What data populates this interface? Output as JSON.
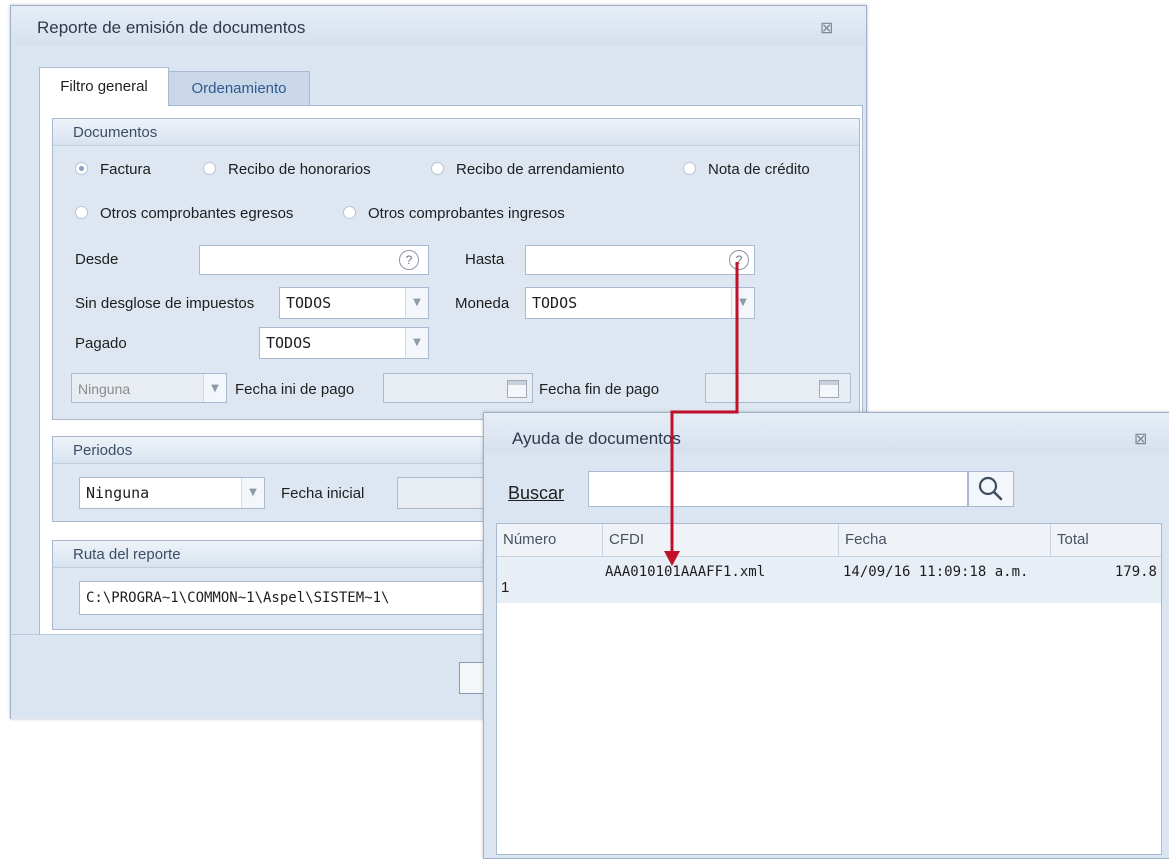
{
  "main_dialog": {
    "title": "Reporte de emisión de documentos",
    "close_glyph": "⊠",
    "tabs": [
      {
        "label": "Filtro general",
        "active": true
      },
      {
        "label": "Ordenamiento",
        "active": false
      }
    ],
    "documentos": {
      "title": "Documentos",
      "doc_types": [
        {
          "label": "Factura",
          "selected": true
        },
        {
          "label": "Recibo de honorarios",
          "selected": false
        },
        {
          "label": "Recibo de arrendamiento",
          "selected": false
        },
        {
          "label": "Nota de crédito",
          "selected": false
        },
        {
          "label": "Otros comprobantes egresos",
          "selected": false
        },
        {
          "label": "Otros comprobantes ingresos",
          "selected": false
        }
      ],
      "desde_label": "Desde",
      "desde_value": "",
      "hasta_label": "Hasta",
      "hasta_value": "",
      "help_glyph": "?",
      "sin_desglose_label": "Sin desglose de impuestos",
      "sin_desglose_value": "TODOS",
      "moneda_label": "Moneda",
      "moneda_value": "TODOS",
      "pagado_label": "Pagado",
      "pagado_value": "TODOS",
      "pago_filter_value": "Ninguna",
      "fecha_ini_pago_label": "Fecha ini de pago",
      "fecha_ini_pago_value": "",
      "fecha_fin_pago_label": "Fecha fin de pago",
      "fecha_fin_pago_value": ""
    },
    "periodos": {
      "title": "Periodos",
      "periodo_value": "Ninguna",
      "fecha_inicial_label": "Fecha inicial",
      "fecha_inicial_value": ""
    },
    "ruta": {
      "title": "Ruta del reporte",
      "path": "C:\\PROGRA~1\\COMMON~1\\Aspel\\SISTEM~1\\"
    }
  },
  "help_dialog": {
    "title": "Ayuda de documentos",
    "close_glyph": "⊠",
    "search_label": "Buscar",
    "search_value": "",
    "columns": [
      "Número",
      "CFDI",
      "Fecha",
      "Total"
    ],
    "rows": [
      {
        "numero": "1",
        "cfdi": "AAA010101AAAFF1.xml",
        "fecha": "14/09/16 11:09:18 a.m.",
        "total": "179.8"
      }
    ]
  },
  "colors": {
    "window_bg": "#dbe5f1",
    "border": "#a9bad0",
    "accent_arrow": "#c0102a",
    "tab_inactive_text": "#2f5b8e"
  },
  "icons": {
    "close": "close-icon",
    "help": "help-icon",
    "dropdown": "chevron-down-icon",
    "calendar": "calendar-icon",
    "search": "search-icon"
  }
}
